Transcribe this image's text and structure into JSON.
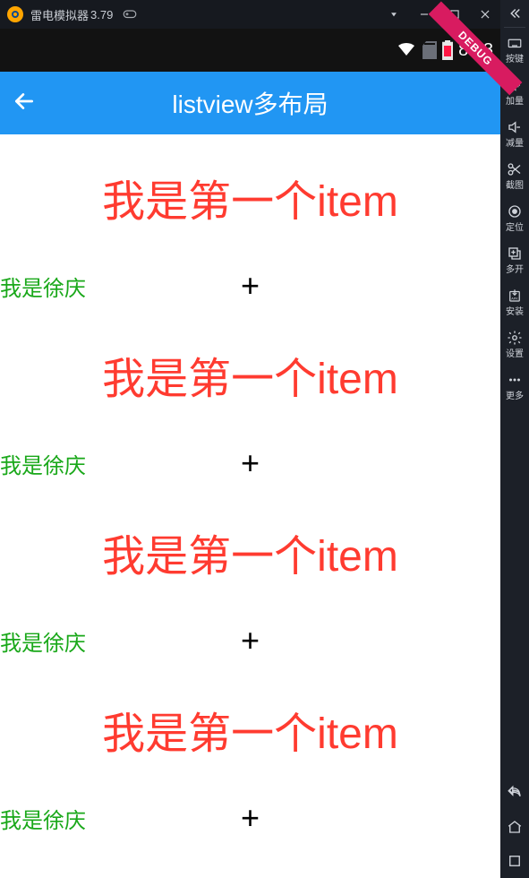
{
  "emulator": {
    "name": "雷电模拟器",
    "version": "3.79"
  },
  "statusbar": {
    "time": "8:08"
  },
  "debug_banner": "DEBUG",
  "appbar": {
    "title": "listview多布局"
  },
  "list": {
    "big_item_text": "我是第一个item",
    "small_item_text": "我是徐庆",
    "plus": "+"
  },
  "sidebar": {
    "items": [
      {
        "label": "按键"
      },
      {
        "label": "加量"
      },
      {
        "label": "减量"
      },
      {
        "label": "截图"
      },
      {
        "label": "定位"
      },
      {
        "label": "多开"
      },
      {
        "label": "安装"
      },
      {
        "label": "设置"
      },
      {
        "label": "更多"
      }
    ]
  }
}
